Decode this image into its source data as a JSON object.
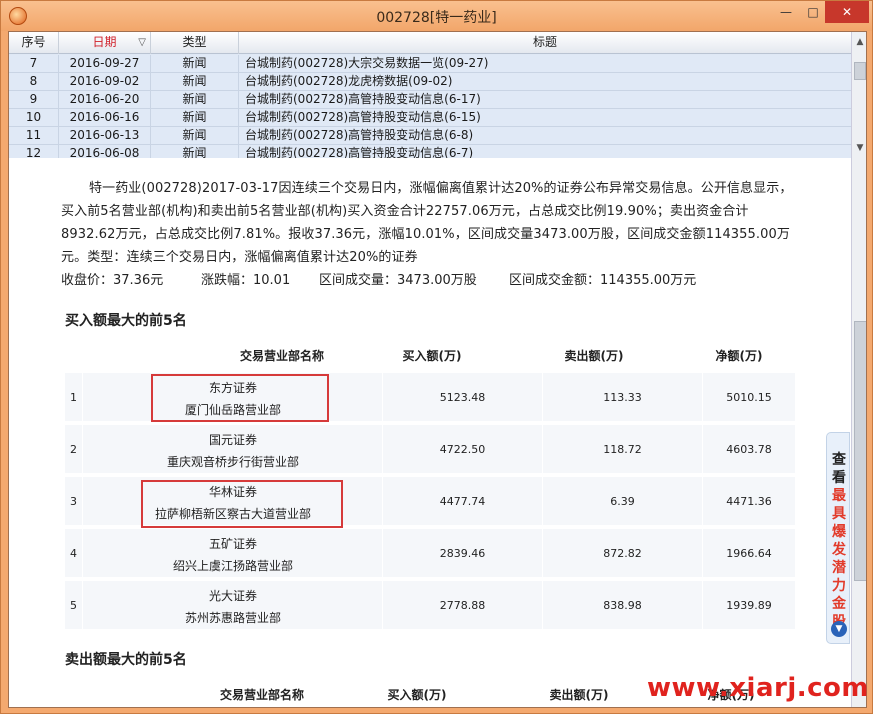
{
  "window": {
    "title": "002728[特一药业]",
    "min_label": "—",
    "max_label": "□",
    "close_label": "✕"
  },
  "list": {
    "headers": {
      "index": "序号",
      "date": "日期",
      "type": "类型",
      "title": "标题"
    },
    "sort_indicator": "▽",
    "rows": [
      {
        "index": "7",
        "date": "2016-09-27",
        "type": "新闻",
        "title": "台城制药(002728)大宗交易数据一览(09-27)"
      },
      {
        "index": "8",
        "date": "2016-09-02",
        "type": "新闻",
        "title": "台城制药(002728)龙虎榜数据(09-02)"
      },
      {
        "index": "9",
        "date": "2016-06-20",
        "type": "新闻",
        "title": "台城制药(002728)高管持股变动信息(6-17)"
      },
      {
        "index": "10",
        "date": "2016-06-16",
        "type": "新闻",
        "title": "台城制药(002728)高管持股变动信息(6-15)"
      },
      {
        "index": "11",
        "date": "2016-06-13",
        "type": "新闻",
        "title": "台城制药(002728)高管持股变动信息(6-8)"
      },
      {
        "index": "12",
        "date": "2016-06-08",
        "type": "新闻",
        "title": "台城制药(002728)高管持股变动信息(6-7)"
      }
    ]
  },
  "detail": {
    "description": "特一药业(002728)2017-03-17因连续三个交易日内，涨幅偏离值累计达20%的证券公布异常交易信息。公开信息显示，买入前5名营业部(机构)和卖出前5名营业部(机构)买入资金合计22757.06万元，占总成交比例19.90%；卖出资金合计8932.62万元，占总成交比例7.81%。报收37.36元，涨幅10.01%，区间成交量3473.00万股，区间成交金额114355.00万元。类型：连续三个交易日内，涨幅偏离值累计达20%的证券",
    "stats": {
      "close": "收盘价：37.36元",
      "change": "涨跌幅：10.01",
      "volume": "区间成交量：3473.00万股",
      "amount": "区间成交金额：114355.00万元"
    },
    "buy_section": {
      "title": "买入额最大的前5名",
      "headers": {
        "name": "交易营业部名称",
        "buy": "买入额(万)",
        "sell": "卖出额(万)",
        "net": "净额(万)"
      },
      "rows": [
        {
          "rank": "1",
          "broker": "东方证券",
          "branch": "厦门仙岳路营业部",
          "buy": "5123.48",
          "sell": "113.33",
          "net": "5010.15"
        },
        {
          "rank": "2",
          "broker": "国元证券",
          "branch": "重庆观音桥步行街营业部",
          "buy": "4722.50",
          "sell": "118.72",
          "net": "4603.78"
        },
        {
          "rank": "3",
          "broker": "华林证券",
          "branch": "拉萨柳梧新区察古大道营业部",
          "buy": "4477.74",
          "sell": "6.39",
          "net": "4471.36"
        },
        {
          "rank": "4",
          "broker": "五矿证券",
          "branch": "绍兴上虞江扬路营业部",
          "buy": "2839.46",
          "sell": "872.82",
          "net": "1966.64"
        },
        {
          "rank": "5",
          "broker": "光大证券",
          "branch": "苏州苏惠路营业部",
          "buy": "2778.88",
          "sell": "838.98",
          "net": "1939.89"
        }
      ]
    },
    "sell_section": {
      "title": "卖出额最大的前5名",
      "headers": {
        "name": "交易营业部名称",
        "buy": "买入额(万)",
        "sell": "卖出额(万)",
        "net": "净额(万)"
      }
    }
  },
  "ad": {
    "line1": "查看",
    "line2": "最具爆发潜力金股",
    "arrow_label": "▼"
  },
  "watermark": "www.xiarj.com",
  "colors": {
    "title_bar": "#f4a96f",
    "close_button": "#c7372b",
    "highlight_box": "#d63a3a",
    "ad_red": "#e23a2a",
    "watermark": "#e0231e"
  }
}
